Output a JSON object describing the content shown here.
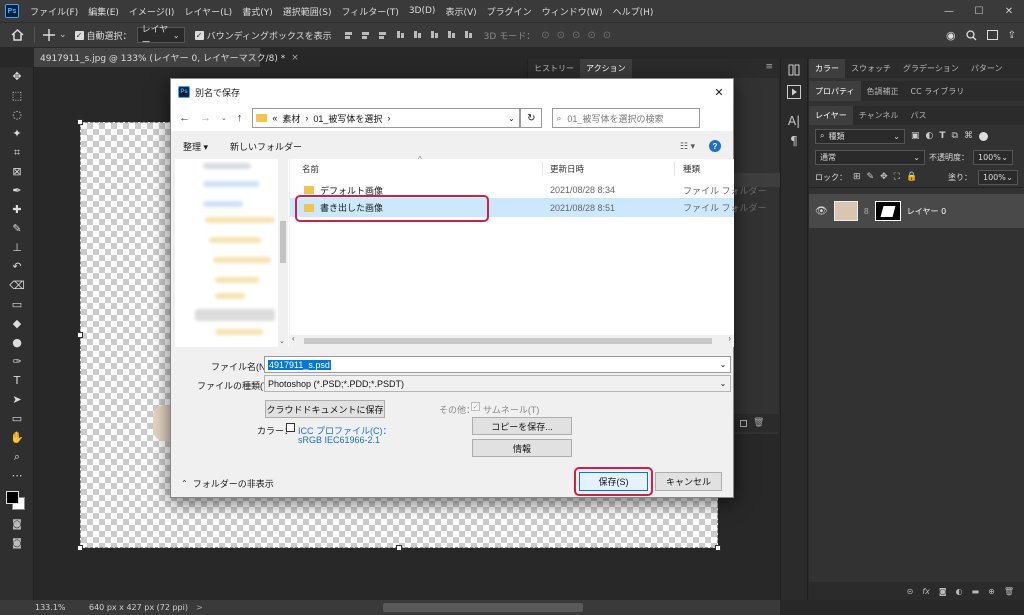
{
  "app": {
    "logo": "Ps"
  },
  "menubar": {
    "items": [
      "ファイル(F)",
      "編集(E)",
      "イメージ(I)",
      "レイヤー(L)",
      "書式(Y)",
      "選択範囲(S)",
      "フィルター(T)",
      "3D(D)",
      "表示(V)",
      "プラグイン",
      "ウィンドウ(W)",
      "ヘルプ(H)"
    ]
  },
  "options": {
    "auto_select_label": "自動選択：",
    "layer_select": "レイヤー",
    "bbox_label": "バウンディングボックスを表示",
    "mode3d": "3D モード："
  },
  "document": {
    "tab_title": "4917911_s.jpg @ 133% (レイヤー 0, レイヤーマスク/8) *",
    "close": "×"
  },
  "history_panel": {
    "tabs": [
      "ヒストリー",
      "アクション"
    ]
  },
  "status": {
    "zoom": "133.1%",
    "info": "640 px x 427 px (72 ppi)",
    "arrow": ">"
  },
  "right_panel": {
    "top_tabs": [
      "カラー",
      "スウォッチ",
      "グラデーション",
      "パターン"
    ],
    "mid_tabs": [
      "プロパティ",
      "色調補正",
      "CC ライブラリ"
    ],
    "layer_tabs": [
      "レイヤー",
      "チャンネル",
      "パス"
    ],
    "kind_label": "種類",
    "blend_mode": "通常",
    "opacity_label": "不透明度：",
    "opacity_value": "100%",
    "lock_label": "ロック：",
    "fill_label": "塗り：",
    "fill_value": "100%",
    "layer_name": "レイヤー 0"
  },
  "dialog": {
    "title": "別名で保存",
    "close": "✕",
    "path": [
      "«",
      "素材",
      "›",
      "01_被写体を選択",
      "›"
    ],
    "search_placeholder": "01_被写体を選択の検索",
    "organize": "整理 ▾",
    "new_folder": "新しいフォルダー",
    "view_toggle": "☷ ▾",
    "help": "?",
    "columns": {
      "name": "名前",
      "modified": "更新日時",
      "type": "種類"
    },
    "files": [
      {
        "name": "デフォルト画像",
        "modified": "2021/08/28 8:34",
        "type": "ファイル フォルダー"
      },
      {
        "name": "書き出した画像",
        "modified": "2021/08/28 8:51",
        "type": "ファイル フォルダー"
      }
    ],
    "filename_label": "ファイル名(N):",
    "filename_value": "4917911_s.psd",
    "filetype_label": "ファイルの種類(T):",
    "filetype_value": "Photoshop (*.PSD;*.PDD;*.PSDT)",
    "cloud_save": "クラウドドキュメントに保存",
    "other_label": "その他：",
    "thumbnail_label": "サムネール(T)",
    "color_label": "カラー：",
    "icc_label": "ICC プロファイル(C)：",
    "icc_value": "sRGB IEC61966-2.1",
    "copy_save": "コピーを保存...",
    "info_btn": "情報",
    "hide_folders": "フォルダーの非表示",
    "save": "保存(S)",
    "cancel": "キャンセル"
  },
  "colors": {
    "accent": "#31a8ff",
    "highlight": "#d0204a",
    "selection": "#cce8ff"
  }
}
